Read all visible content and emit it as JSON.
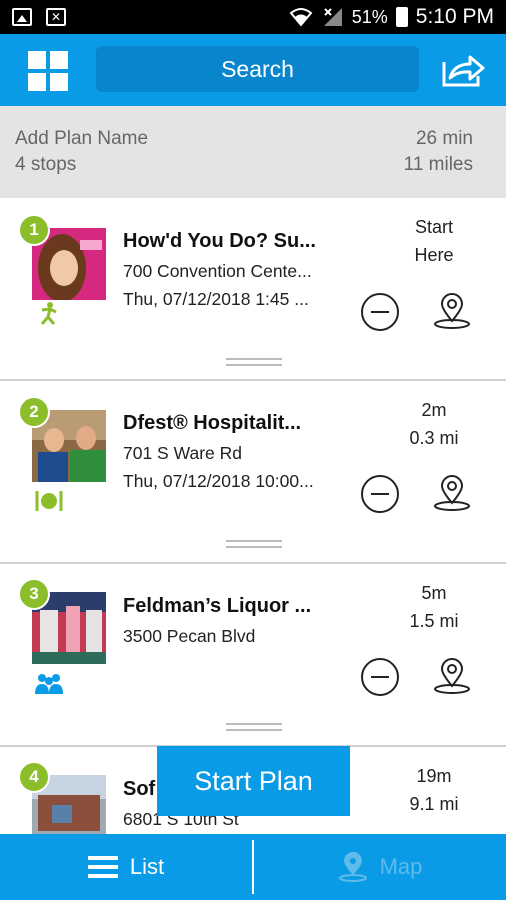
{
  "status_bar": {
    "battery": "51%",
    "time": "5:10 PM"
  },
  "header": {
    "search_label": "Search"
  },
  "plan": {
    "name_placeholder": "Add Plan Name",
    "stops_count": "4 stops",
    "total_duration": "26 min",
    "total_distance": "11 miles"
  },
  "stops": [
    {
      "number": "1",
      "title": "How'd You Do?  Su...",
      "address": "700 Convention Cente...",
      "datetime": "Thu, 07/12/2018 1:45 ...",
      "meta_line1": "Start",
      "meta_line2": "Here",
      "category_icon": "person-activity-icon"
    },
    {
      "number": "2",
      "title": "Dfest® Hospitalit...",
      "address": "701 S Ware Rd",
      "datetime": "Thu, 07/12/2018 10:00...",
      "meta_line1": "2m",
      "meta_line2": "0.3 mi",
      "category_icon": "food-icon"
    },
    {
      "number": "3",
      "title": "Feldman’s Liquor ...",
      "address": "3500 Pecan Blvd",
      "datetime": "",
      "meta_line1": "5m",
      "meta_line2": "1.5 mi",
      "category_icon": "group-icon"
    },
    {
      "number": "4",
      "title": "Sof",
      "address": "6801 S 10th St",
      "datetime": "",
      "meta_line1": "19m",
      "meta_line2": "9.1 mi",
      "category_icon": ""
    }
  ],
  "start_plan_label": "Start Plan",
  "bottom_nav": {
    "list_label": "List",
    "map_label": "Map"
  },
  "colors": {
    "primary": "#0a9be6",
    "stop_badge": "#8cbe2c",
    "summary_bg": "#e4e4e4"
  }
}
